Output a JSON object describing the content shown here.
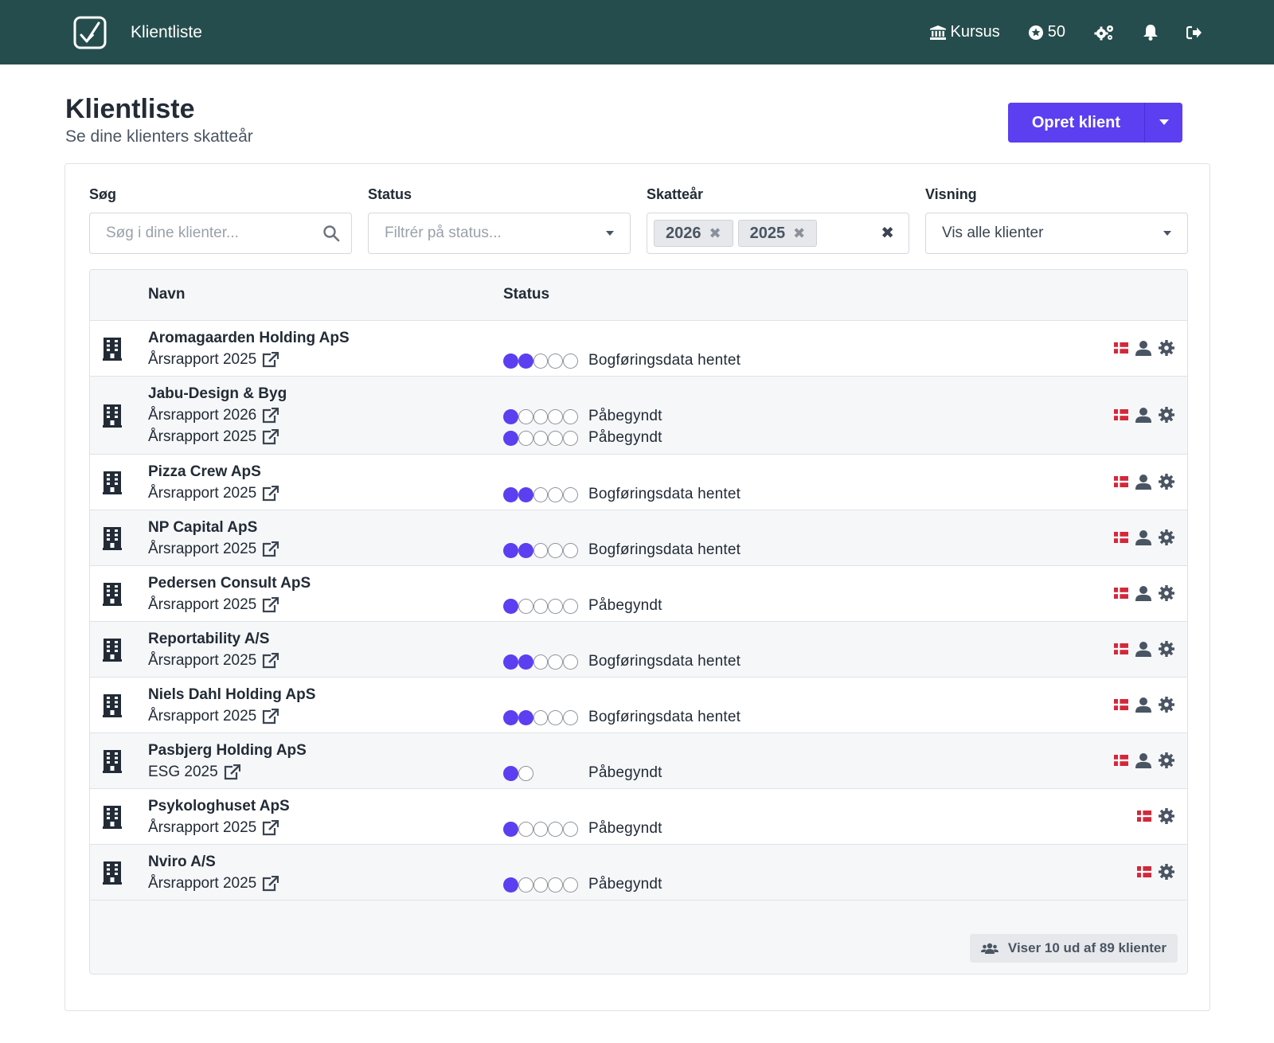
{
  "topbar": {
    "title": "Klientliste",
    "kursus_label": "Kursus",
    "points": "50",
    "icons": [
      "check-logo-icon",
      "bank-icon",
      "star-icon",
      "gears-icon",
      "bell-icon",
      "sign-out-icon"
    ]
  },
  "page": {
    "title": "Klientliste",
    "subtitle": "Se dine klienters skatteår",
    "create_button": "Opret klient"
  },
  "filters": {
    "search": {
      "label": "Søg",
      "placeholder": "Søg i dine klienter..."
    },
    "status": {
      "label": "Status",
      "placeholder": "Filtrér på status..."
    },
    "tax_year": {
      "label": "Skatteår",
      "chips": [
        "2026",
        "2025"
      ]
    },
    "view": {
      "label": "Visning",
      "value": "Vis alle klienter"
    }
  },
  "table": {
    "headers": {
      "name": "Navn",
      "status": "Status"
    },
    "rows": [
      {
        "name": "Aromagaarden Holding ApS",
        "reports": [
          {
            "label": "Årsrapport 2025",
            "filled": 2,
            "total": 5,
            "status": "Bogføringsdata hentet"
          }
        ],
        "has_user": true
      },
      {
        "name": "Jabu-Design & Byg",
        "reports": [
          {
            "label": "Årsrapport 2026",
            "filled": 1,
            "total": 5,
            "status": "Påbegyndt"
          },
          {
            "label": "Årsrapport 2025",
            "filled": 1,
            "total": 5,
            "status": "Påbegyndt"
          }
        ],
        "has_user": true
      },
      {
        "name": "Pizza Crew ApS",
        "reports": [
          {
            "label": "Årsrapport 2025",
            "filled": 2,
            "total": 5,
            "status": "Bogføringsdata hentet"
          }
        ],
        "has_user": true
      },
      {
        "name": "NP Capital ApS",
        "reports": [
          {
            "label": "Årsrapport 2025",
            "filled": 2,
            "total": 5,
            "status": "Bogføringsdata hentet"
          }
        ],
        "has_user": true
      },
      {
        "name": "Pedersen Consult ApS",
        "reports": [
          {
            "label": "Årsrapport 2025",
            "filled": 1,
            "total": 5,
            "status": "Påbegyndt"
          }
        ],
        "has_user": true
      },
      {
        "name": "Reportability A/S",
        "reports": [
          {
            "label": "Årsrapport 2025",
            "filled": 2,
            "total": 5,
            "status": "Bogføringsdata hentet"
          }
        ],
        "has_user": true
      },
      {
        "name": "Niels Dahl Holding ApS",
        "reports": [
          {
            "label": "Årsrapport 2025",
            "filled": 2,
            "total": 5,
            "status": "Bogføringsdata hentet"
          }
        ],
        "has_user": true
      },
      {
        "name": "Pasbjerg Holding ApS",
        "reports": [
          {
            "label": "ESG 2025",
            "filled": 1,
            "total": 2,
            "status": "Påbegyndt"
          }
        ],
        "has_user": true
      },
      {
        "name": "Psykologhuset ApS",
        "reports": [
          {
            "label": "Årsrapport 2025",
            "filled": 1,
            "total": 5,
            "status": "Påbegyndt"
          }
        ],
        "has_user": false
      },
      {
        "name": "Nviro A/S",
        "reports": [
          {
            "label": "Årsrapport 2025",
            "filled": 1,
            "total": 5,
            "status": "Påbegyndt"
          }
        ],
        "has_user": false
      }
    ],
    "footer_count": "Viser 10 ud af 89 klienter"
  },
  "colors": {
    "topbar": "#264d4d",
    "accent": "#5b3ff0",
    "flag_red": "#d4283a"
  }
}
